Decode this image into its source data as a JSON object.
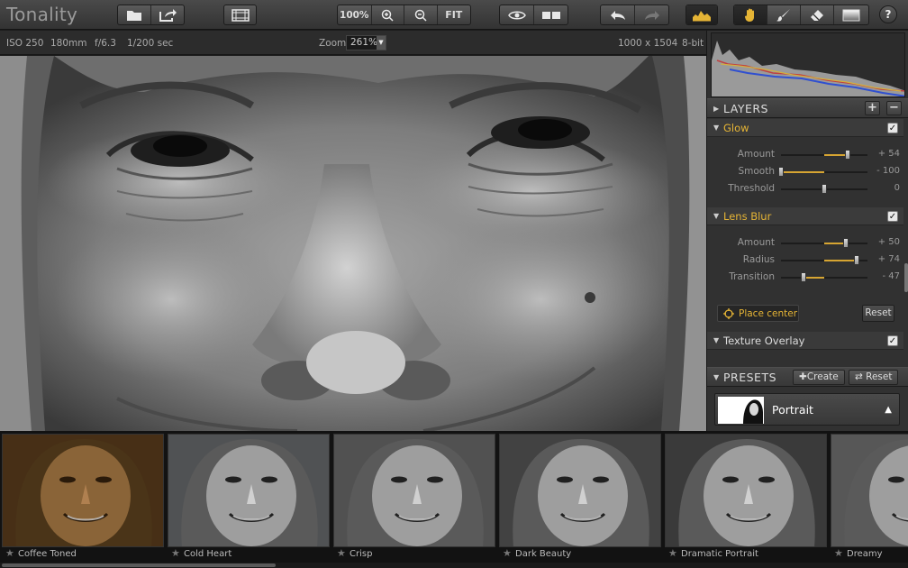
{
  "app": {
    "title": "Tonality"
  },
  "toolbar": {
    "zoom_100_label": "100%",
    "fit_label": "FIT",
    "help_label": "?"
  },
  "info": {
    "iso": "ISO 250",
    "focal": "180mm",
    "aperture": "f/6.3",
    "shutter": "1/200 sec",
    "zoom_label": "Zoom",
    "zoom_value": "261%",
    "dimensions": "1000 x 1504",
    "bitdepth": "8-bit"
  },
  "panel": {
    "layers_title": "LAYERS",
    "add_label": "+",
    "remove_label": "−",
    "glow": {
      "name": "Glow",
      "sliders": [
        {
          "label": "Amount",
          "value": "+ 54",
          "fraction": 0.77
        },
        {
          "label": "Smooth",
          "value": "- 100",
          "fraction": 0.0
        },
        {
          "label": "Threshold",
          "value": "0",
          "fraction": 0.5
        }
      ]
    },
    "lens_blur": {
      "name": "Lens Blur",
      "sliders": [
        {
          "label": "Amount",
          "value": "+ 50",
          "fraction": 0.75
        },
        {
          "label": "Radius",
          "value": "+ 74",
          "fraction": 0.87
        },
        {
          "label": "Transition",
          "value": "- 47",
          "fraction": 0.265
        }
      ]
    },
    "place_center_label": "Place center",
    "reset_label": "Reset",
    "texture_overlay": {
      "name": "Texture Overlay"
    },
    "presets_title": "PRESETS",
    "create_label": "Create",
    "presets_reset_label": "Reset",
    "current_preset": "Portrait"
  },
  "filmstrip": {
    "items": [
      {
        "label": "Coffee Toned",
        "tone": "#6a4a26"
      },
      {
        "label": "Cold Heart",
        "tone": "#8a8e93"
      },
      {
        "label": "Crisp",
        "tone": "#8c8c8c"
      },
      {
        "label": "Dark Beauty",
        "tone": "#6c6c6c"
      },
      {
        "label": "Dramatic Portrait",
        "tone": "#5a5a5a"
      },
      {
        "label": "Dreamy",
        "tone": "#9a9a9a"
      }
    ]
  },
  "colors": {
    "accent": "#e5b435",
    "panel_bg": "#313131"
  }
}
